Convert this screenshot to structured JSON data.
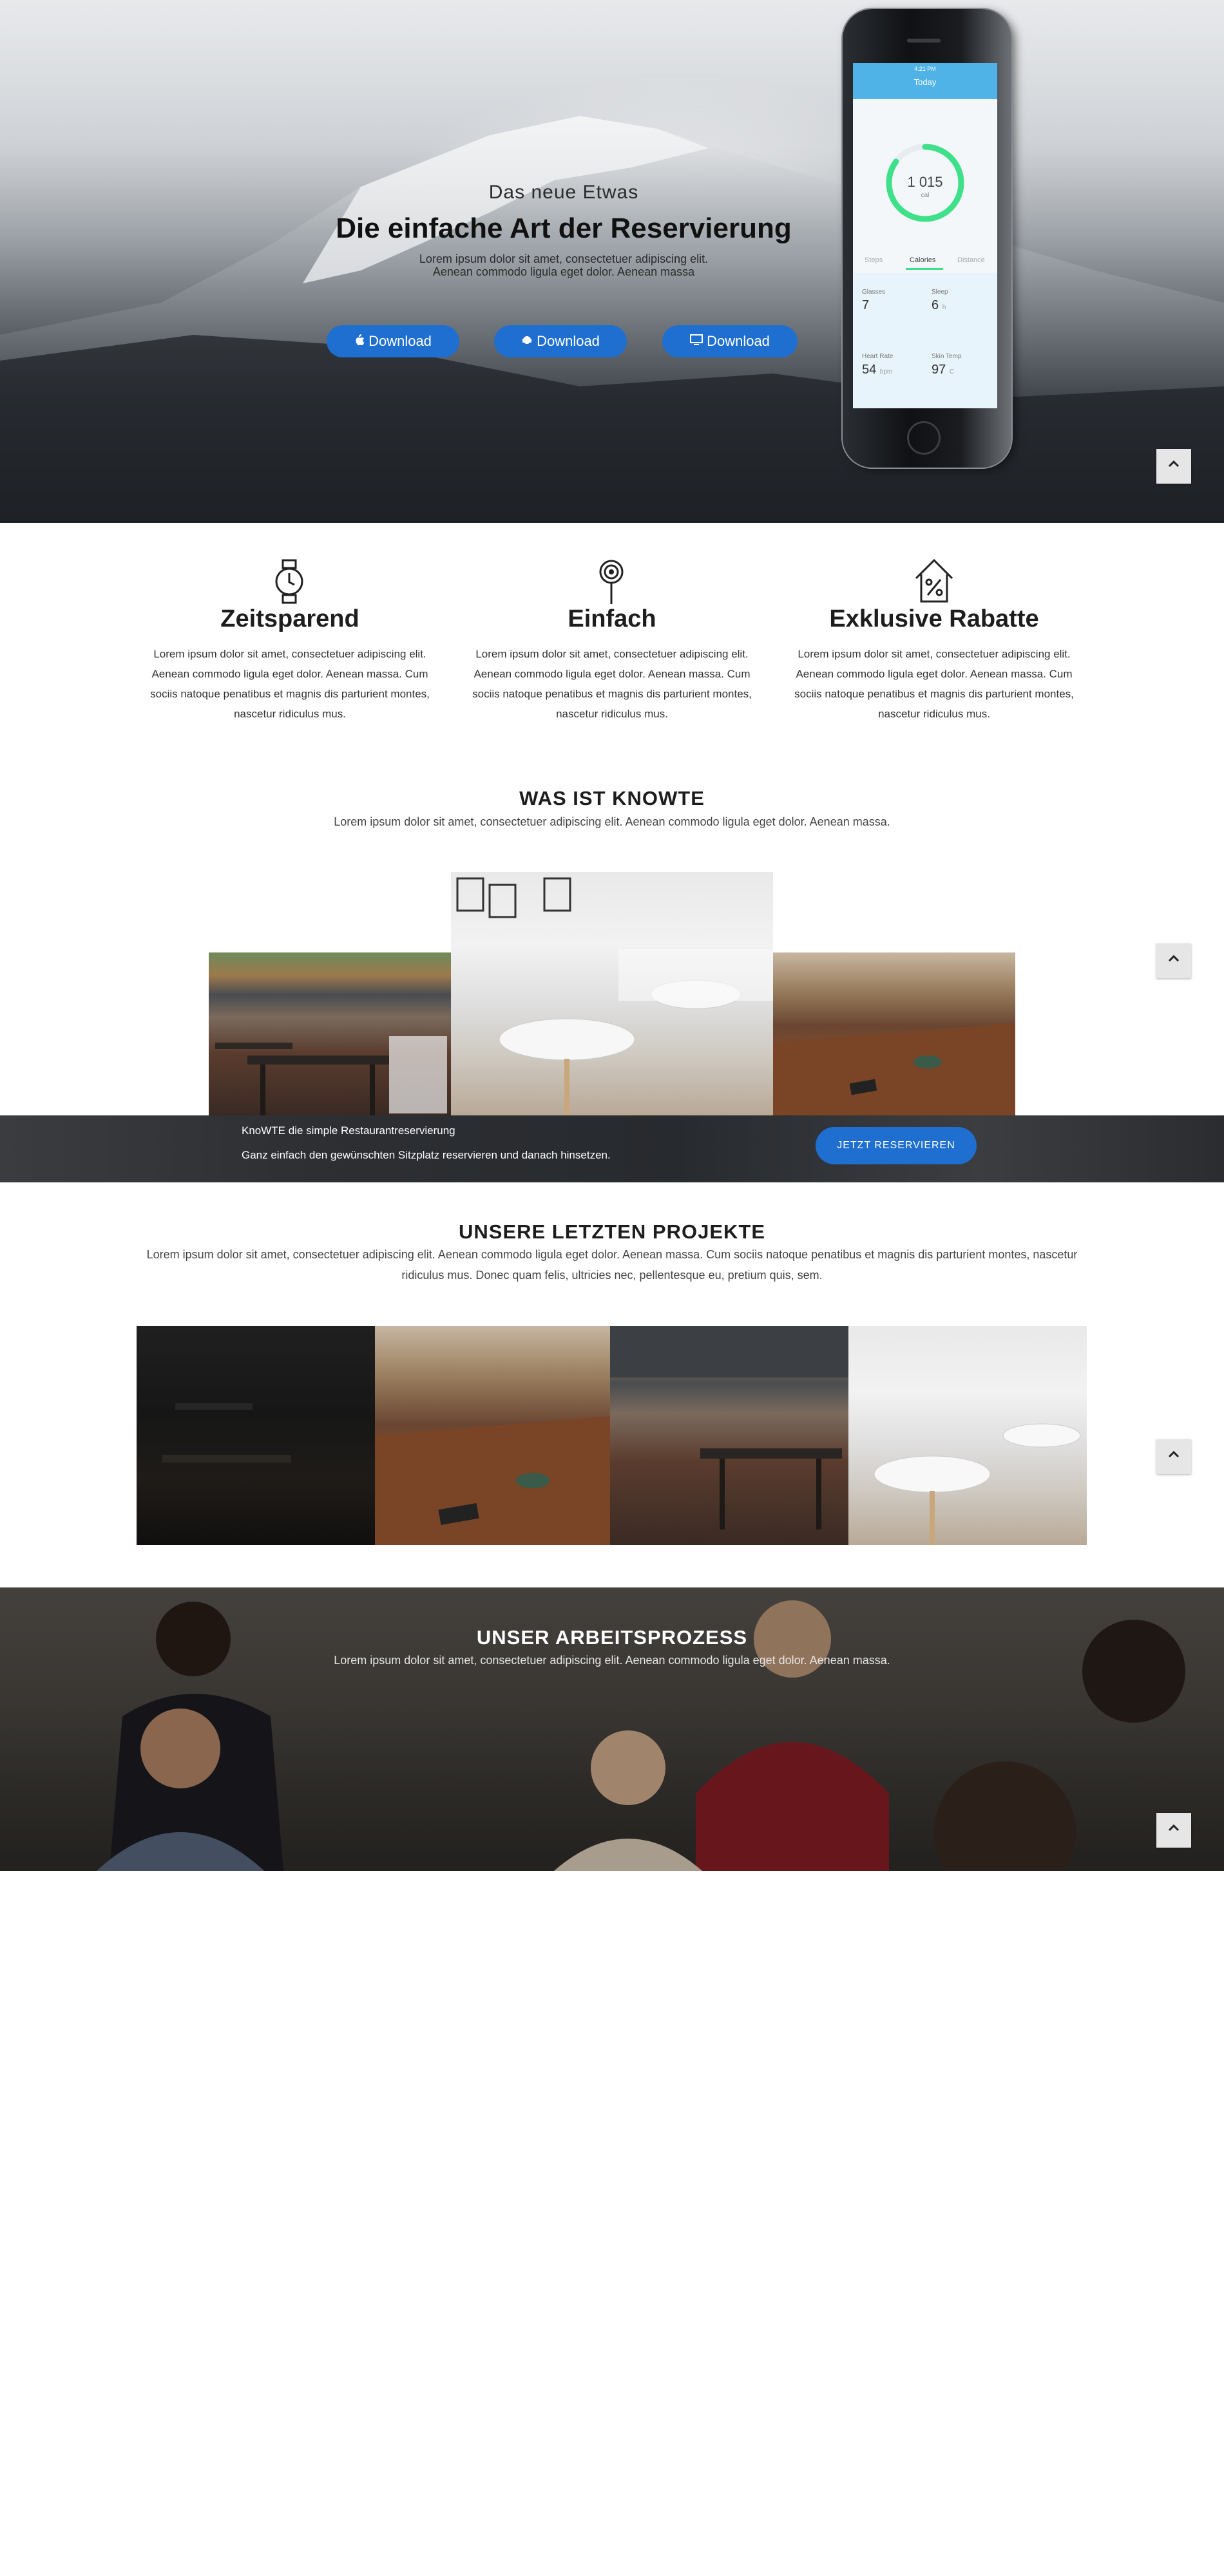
{
  "hero": {
    "kicker": "Das neue Etwas",
    "title": "Die einfache Art der Reservierung",
    "description": "Lorem ipsum dolor sit amet, consectetuer adipiscing elit. Aenean commodo ligula eget dolor. Aenean massa",
    "buttons": [
      {
        "label": "Download",
        "icon": "apple-icon"
      },
      {
        "label": "Download",
        "icon": "android-icon"
      },
      {
        "label": "Download",
        "icon": "desktop-icon"
      }
    ],
    "phone": {
      "time": "4:21 PM",
      "screen_title": "Today",
      "ring_value": "1 015",
      "ring_unit": "cal",
      "ring_progress": 0.85,
      "tabs": [
        "Steps",
        "Calories",
        "Distance"
      ],
      "active_tab": "Calories",
      "stats": [
        {
          "label": "Glasses",
          "value": "7",
          "unit": ""
        },
        {
          "label": "Sleep",
          "value": "6",
          "unit": "h"
        },
        {
          "label": "Heart Rate",
          "value": "54",
          "unit": "bpm"
        },
        {
          "label": "Skin Temp",
          "value": "97",
          "unit": "C"
        }
      ]
    }
  },
  "features": [
    {
      "icon": "watch-icon",
      "title": "Zeitsparend",
      "text": "Lorem ipsum dolor sit amet, consectetuer adipiscing elit. Aenean commodo ligula eget dolor. Aenean massa. Cum sociis natoque penatibus et magnis dis parturient montes, nascetur ridiculus mus."
    },
    {
      "icon": "lollipop-icon",
      "title": "Einfach",
      "text": "Lorem ipsum dolor sit amet, consectetuer adipiscing elit. Aenean commodo ligula eget dolor. Aenean massa. Cum sociis natoque penatibus et magnis dis parturient montes, nascetur ridiculus mus."
    },
    {
      "icon": "discount-house-icon",
      "title": "Exklusive Rabatte",
      "text": "Lorem ipsum dolor sit amet, consectetuer adipiscing elit. Aenean commodo ligula eget dolor. Aenean massa. Cum sociis natoque penatibus et magnis dis parturient montes, nascetur ridiculus mus."
    }
  ],
  "about": {
    "title": "WAS IST KNOWTE",
    "subtitle": "Lorem ipsum dolor sit amet, consectetuer adipiscing elit. Aenean commodo ligula eget dolor. Aenean massa."
  },
  "banner": {
    "line1": "KnoWTE die simple Restaurantreservierung",
    "line2": "Ganz einfach den gewünschten Sitzplatz reservieren und danach hinsetzen.",
    "button": "JETZT RESERVIEREN"
  },
  "projects": {
    "title": "UNSERE LETZTEN PROJEKTE",
    "subtitle": "Lorem ipsum dolor sit amet, consectetuer adipiscing elit. Aenean commodo ligula eget dolor. Aenean massa. Cum sociis natoque penatibus et magnis dis parturient montes, nascetur ridiculus mus. Donec quam felis, ultricies nec, pellentesque eu, pretium quis, sem."
  },
  "process": {
    "title": "UNSER ARBEITSPROZESS",
    "subtitle": "Lorem ipsum dolor sit amet, consectetuer adipiscing elit. Aenean commodo ligula eget dolor. Aenean massa."
  },
  "colors": {
    "accent": "#1f6fd1",
    "phone_bar": "#4fb3e8",
    "ring": "#3ee08a"
  }
}
